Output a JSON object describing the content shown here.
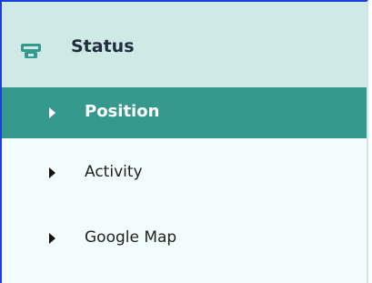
{
  "section": {
    "title": "Status",
    "icon": "router-icon"
  },
  "menu": {
    "items": [
      {
        "label": "Position",
        "active": true,
        "icon": "caret-right-icon"
      },
      {
        "label": "Activity",
        "active": false,
        "icon": "caret-right-icon"
      },
      {
        "label": "Google Map",
        "active": false,
        "icon": "caret-right-icon"
      }
    ]
  },
  "colors": {
    "header_bg": "#cfe9e6",
    "active_bg": "#36998e",
    "panel_bg": "#f2fcfb",
    "border_accent": "#1c3fd6",
    "icon_color": "#36998e"
  }
}
